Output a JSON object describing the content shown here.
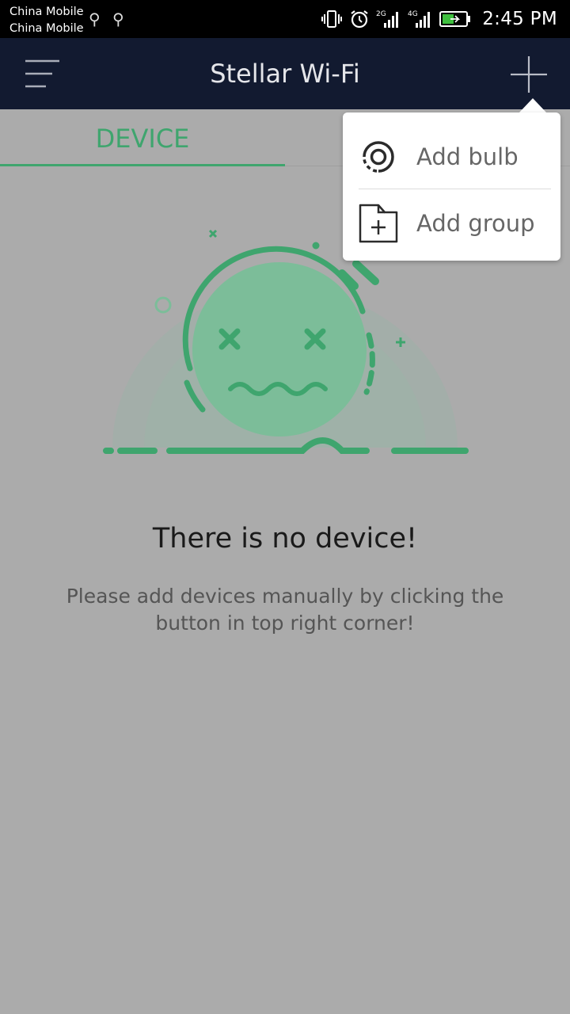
{
  "status_bar": {
    "carrier_1": "China Mobile",
    "carrier_2": "China Mobile",
    "network_1": "2G",
    "network_2": "4G",
    "time": "2:45 PM"
  },
  "app_bar": {
    "title": "Stellar Wi-Fi",
    "menu_icon": "hamburger-menu-icon",
    "add_icon": "plus-icon"
  },
  "tabs": [
    {
      "label": "DEVICE",
      "active": true
    }
  ],
  "empty_state": {
    "title": "There is no device!",
    "hint": "Please add devices manually by clicking the button in top right corner!"
  },
  "popup_menu": {
    "items": [
      {
        "label": "Add bulb",
        "icon": "bulb-icon"
      },
      {
        "label": "Add group",
        "icon": "add-folder-icon"
      }
    ]
  },
  "colors": {
    "accent": "#3fa56e",
    "app_bar": "#121a30",
    "overlay_background": "#ababab"
  }
}
